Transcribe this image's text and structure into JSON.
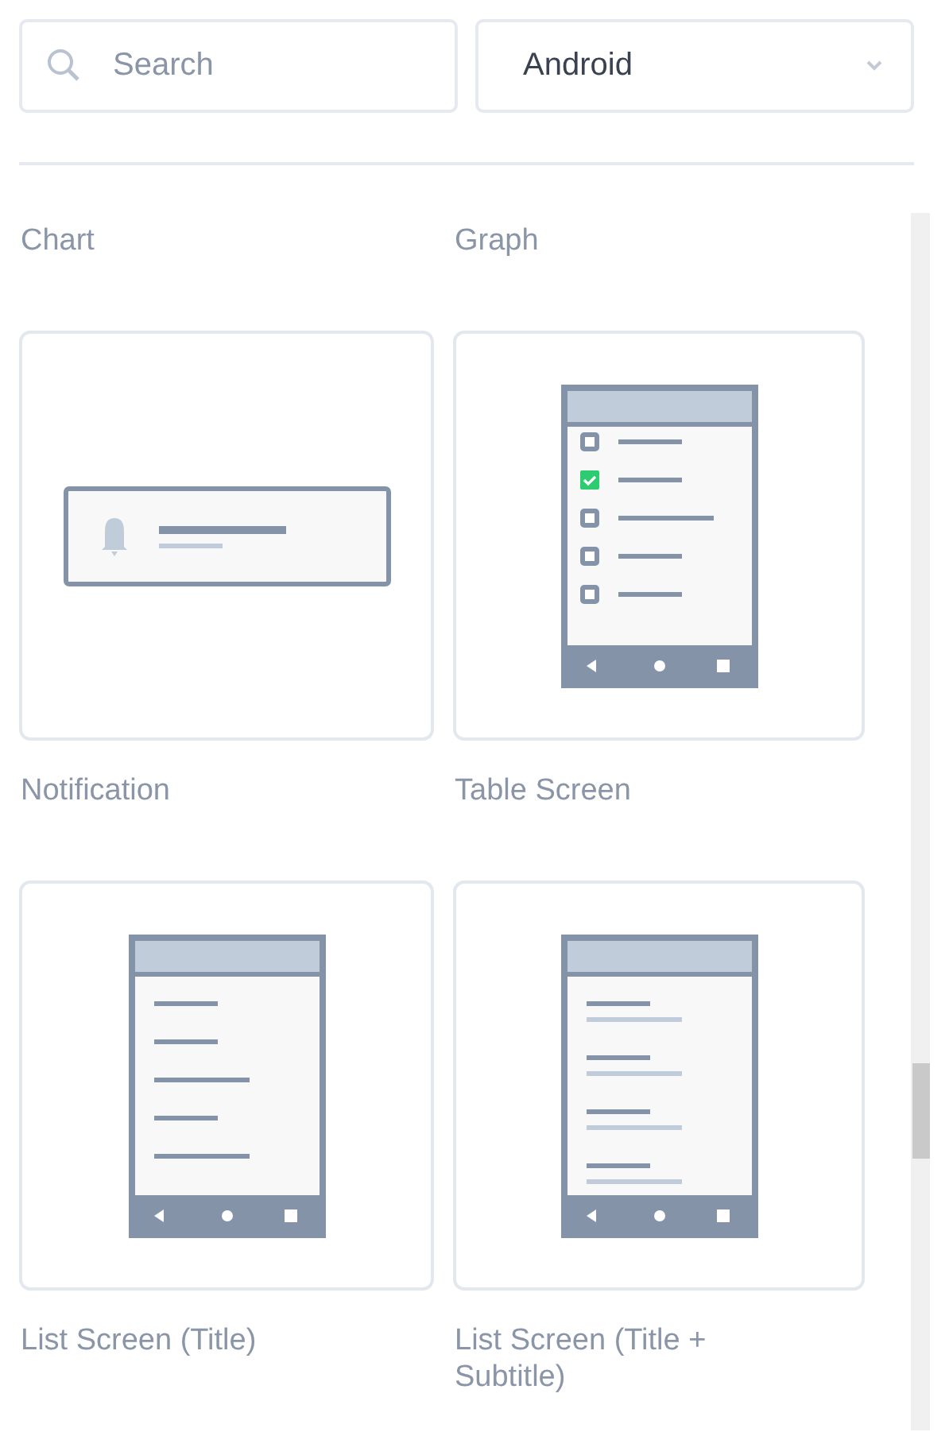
{
  "search": {
    "placeholder": "Search"
  },
  "platform_select": {
    "value": "Android"
  },
  "templates": [
    {
      "kind": "caption",
      "label": "Chart"
    },
    {
      "kind": "caption",
      "label": "Graph"
    },
    {
      "kind": "notification",
      "label": "Notification"
    },
    {
      "kind": "table",
      "label": "Table Screen",
      "rows": [
        {
          "checked": false
        },
        {
          "checked": true
        },
        {
          "checked": false
        },
        {
          "checked": false
        },
        {
          "checked": false
        }
      ]
    },
    {
      "kind": "list",
      "label": "List Screen (Title)"
    },
    {
      "kind": "list-subtitle",
      "label": "List Screen (Title + Subtitle)"
    }
  ]
}
